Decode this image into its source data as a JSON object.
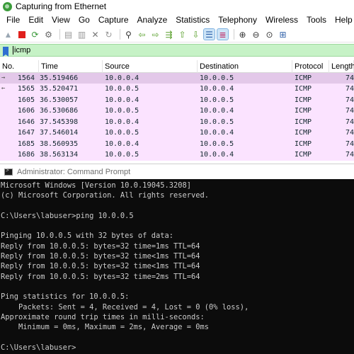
{
  "wireshark": {
    "title": "Capturing from Ethernet",
    "menu": [
      "File",
      "Edit",
      "View",
      "Go",
      "Capture",
      "Analyze",
      "Statistics",
      "Telephony",
      "Wireless",
      "Tools",
      "Help"
    ],
    "filter": {
      "value": "icmp"
    },
    "columns": [
      "No.",
      "Time",
      "Source",
      "Destination",
      "Protocol",
      "Length"
    ],
    "packets": [
      {
        "no": "1564",
        "time": "35.519466",
        "src": "10.0.0.4",
        "dst": "10.0.0.5",
        "proto": "ICMP",
        "len": "74",
        "arrow": "→"
      },
      {
        "no": "1565",
        "time": "35.520471",
        "src": "10.0.0.5",
        "dst": "10.0.0.4",
        "proto": "ICMP",
        "len": "74",
        "arrow": "←"
      },
      {
        "no": "1605",
        "time": "36.530057",
        "src": "10.0.0.4",
        "dst": "10.0.0.5",
        "proto": "ICMP",
        "len": "74",
        "arrow": ""
      },
      {
        "no": "1606",
        "time": "36.530686",
        "src": "10.0.0.5",
        "dst": "10.0.0.4",
        "proto": "ICMP",
        "len": "74",
        "arrow": ""
      },
      {
        "no": "1646",
        "time": "37.545398",
        "src": "10.0.0.4",
        "dst": "10.0.0.5",
        "proto": "ICMP",
        "len": "74",
        "arrow": ""
      },
      {
        "no": "1647",
        "time": "37.546014",
        "src": "10.0.0.5",
        "dst": "10.0.0.4",
        "proto": "ICMP",
        "len": "74",
        "arrow": ""
      },
      {
        "no": "1685",
        "time": "38.560935",
        "src": "10.0.0.4",
        "dst": "10.0.0.5",
        "proto": "ICMP",
        "len": "74",
        "arrow": ""
      },
      {
        "no": "1686",
        "time": "38.563134",
        "src": "10.0.0.5",
        "dst": "10.0.0.4",
        "proto": "ICMP",
        "len": "74",
        "arrow": ""
      }
    ],
    "colors": {
      "icmp_row": "#fbe3ff",
      "selected_row": "#e3c8e9",
      "filter_ok": "#c6f2c6"
    }
  },
  "cmd": {
    "title": "Administrator: Command Prompt",
    "lines": [
      "Microsoft Windows [Version 10.0.19045.3208]",
      "(c) Microsoft Corporation. All rights reserved.",
      "",
      "C:\\Users\\labuser>ping 10.0.0.5",
      "",
      "Pinging 10.0.0.5 with 32 bytes of data:",
      "Reply from 10.0.0.5: bytes=32 time=1ms TTL=64",
      "Reply from 10.0.0.5: bytes=32 time<1ms TTL=64",
      "Reply from 10.0.0.5: bytes=32 time<1ms TTL=64",
      "Reply from 10.0.0.5: bytes=32 time=2ms TTL=64",
      "",
      "Ping statistics for 10.0.0.5:",
      "    Packets: Sent = 4, Received = 4, Lost = 0 (0% loss),",
      "Approximate round trip times in milli-seconds:",
      "    Minimum = 0ms, Maximum = 2ms, Average = 0ms",
      "",
      "C:\\Users\\labuser>"
    ]
  }
}
